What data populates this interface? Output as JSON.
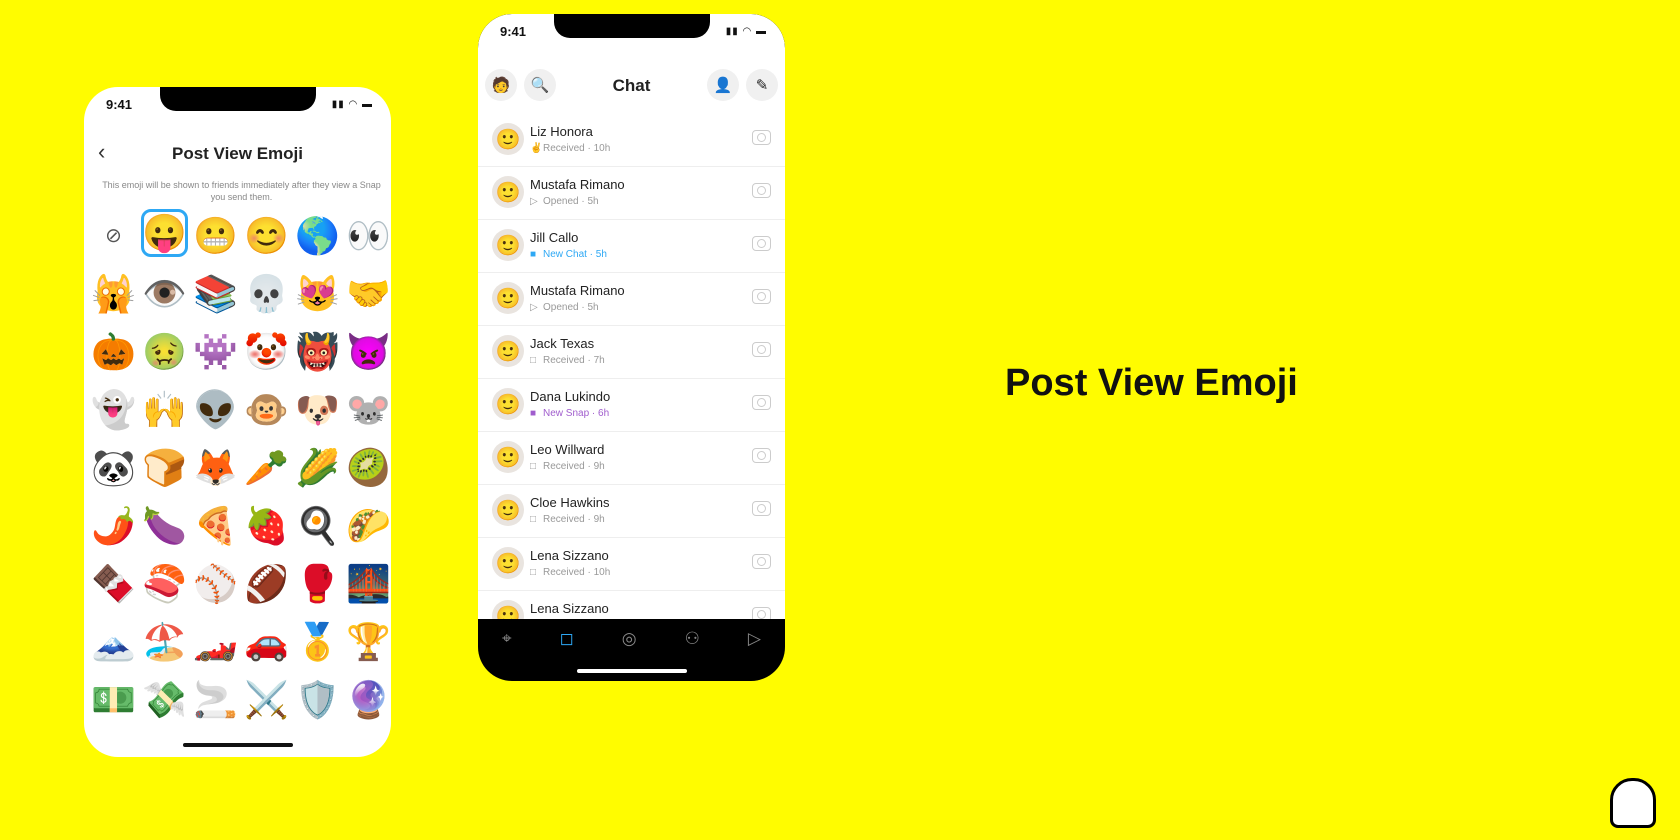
{
  "emoji_screen": {
    "time": "9:41",
    "title": "Post View Emoji",
    "back_icon": "chevron-left-icon",
    "description": "This emoji will be shown to friends immediately after they view a Snap you send them.",
    "selected": "😛",
    "accent": "#2EA8F4",
    "emojis": [
      "⊘",
      "😛",
      "😬",
      "😊",
      "🌎",
      "👀",
      "🙀",
      "👁️",
      "📚",
      "💀",
      "😻",
      "🤝",
      "🎃",
      "🤢",
      "👾",
      "🤡",
      "👹",
      "👿",
      "👻",
      "🙌",
      "👽",
      "🐵",
      "🐶",
      "🐭",
      "🐼",
      "🍞",
      "🦊",
      "🥕",
      "🌽",
      "🥝",
      "🌶️",
      "🍆",
      "🍕",
      "🍓",
      "🍳",
      "🌮",
      "🍫",
      "🍣",
      "⚾",
      "🏈",
      "🥊",
      "🌉",
      "🗻",
      "🏖️",
      "🏎️",
      "🚗",
      "🥇",
      "🏆",
      "💵",
      "💸",
      "🚬",
      "⚔️",
      "🛡️",
      "🔮"
    ]
  },
  "chat_screen": {
    "time": "9:41",
    "title": "Chat",
    "chats": [
      {
        "name": "Liz Honora",
        "status": "Received",
        "time": "10h",
        "color": "#999",
        "icon": "✌"
      },
      {
        "name": "Mustafa Rimano",
        "status": "Opened",
        "time": "5h",
        "color": "#999",
        "icon": "▷"
      },
      {
        "name": "Jill Callo",
        "status": "New Chat",
        "time": "5h",
        "color": "#2EA8F4",
        "icon": "■"
      },
      {
        "name": "Mustafa Rimano",
        "status": "Opened",
        "time": "5h",
        "color": "#999",
        "icon": "▷"
      },
      {
        "name": "Jack Texas",
        "status": "Received",
        "time": "7h",
        "color": "#999",
        "icon": "□"
      },
      {
        "name": "Dana Lukindo",
        "status": "New Snap",
        "time": "6h",
        "color": "#A05DCD",
        "icon": "■"
      },
      {
        "name": "Leo Willward",
        "status": "Received",
        "time": "9h",
        "color": "#999",
        "icon": "□"
      },
      {
        "name": "Cloe Hawkins",
        "status": "Received",
        "time": "9h",
        "color": "#999",
        "icon": "□"
      },
      {
        "name": "Lena Sizzano",
        "status": "Received",
        "time": "10h",
        "color": "#999",
        "icon": "□"
      },
      {
        "name": "Lena Sizzano",
        "status": "",
        "time": "",
        "color": "#999",
        "icon": ""
      }
    ],
    "nav": [
      "map-icon",
      "chat-icon",
      "camera-icon",
      "friends-icon",
      "stories-icon"
    ]
  },
  "headline": "Post View Emoji",
  "colors": {
    "background": "#FFFC00"
  }
}
